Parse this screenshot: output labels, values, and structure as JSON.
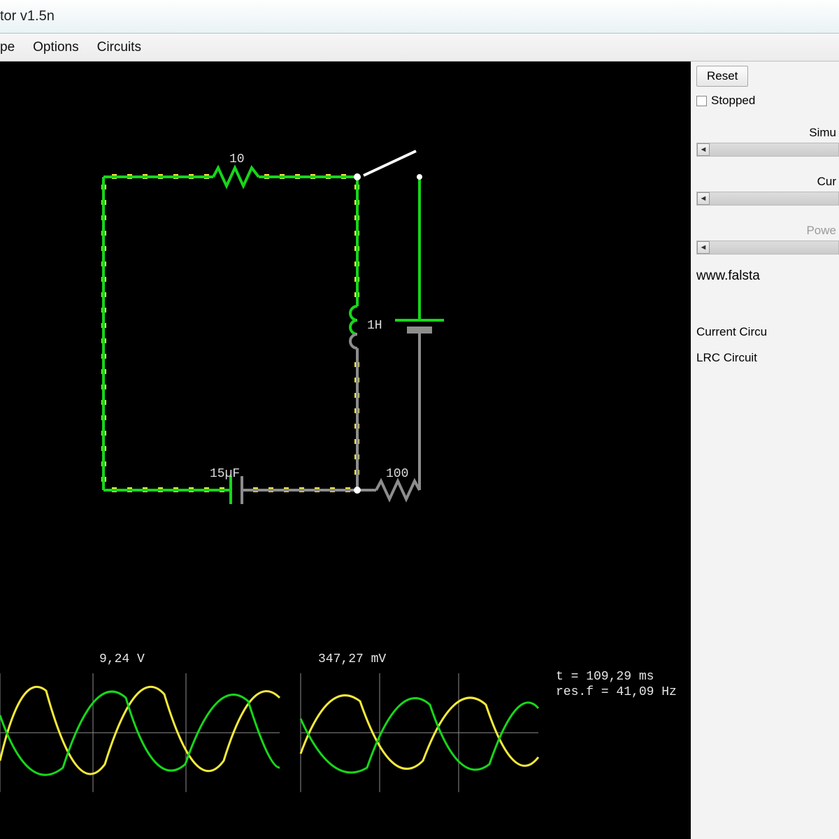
{
  "window": {
    "title_fragment": "tor v1.5n"
  },
  "menu": {
    "item0": "pe",
    "item1": "Options",
    "item2": "Circuits"
  },
  "sidebar": {
    "reset": "Reset",
    "stopped": "Stopped",
    "sim_label_frag": "Simu",
    "current_label_frag": "Cur",
    "power_label_frag": "Powe",
    "link_frag": "www.falsta",
    "info1": "Current Circu",
    "info2": "LRC Circuit"
  },
  "circuit": {
    "resistor1_value": "10",
    "inductor_value": "1H",
    "capacitor_value": "15µF",
    "resistor2_value": "100"
  },
  "scope": {
    "v1": "9,24 V",
    "v2": "347,27 mV",
    "status_t": "t = 109,29 ms",
    "status_f": "res.f = 41,09 Hz"
  }
}
